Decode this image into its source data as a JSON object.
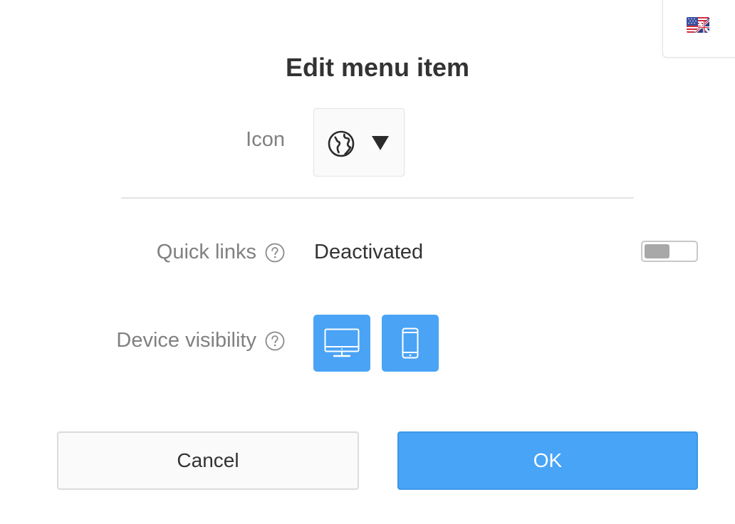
{
  "language": {
    "flag_icon": "uk-us-flag-icon"
  },
  "dialog": {
    "title": "Edit menu item"
  },
  "icon_field": {
    "label": "Icon",
    "selected_icon": "globe-icon",
    "dropdown_icon": "caret-down-icon"
  },
  "quick_links": {
    "label": "Quick links",
    "help_icon": "question-circle-icon",
    "status": "Deactivated",
    "enabled": false
  },
  "device_visibility": {
    "label": "Device visibility",
    "help_icon": "question-circle-icon",
    "desktop_icon": "desktop-monitor-icon",
    "mobile_icon": "mobile-phone-icon"
  },
  "actions": {
    "cancel_label": "Cancel",
    "ok_label": "OK"
  },
  "colors": {
    "primary": "#48a4f6",
    "label_gray": "#808080",
    "text_dark": "#333333"
  }
}
